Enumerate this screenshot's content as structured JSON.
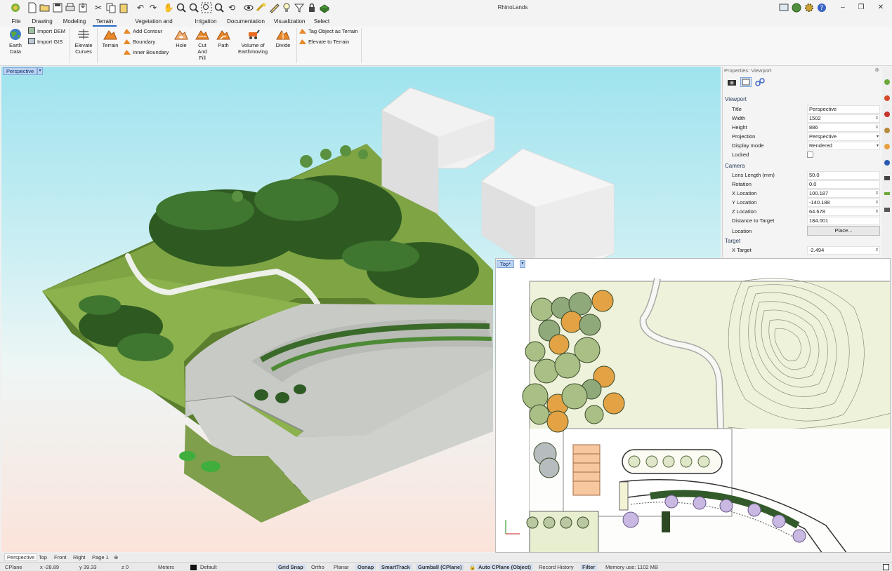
{
  "app": {
    "title": "RhinoLands"
  },
  "quick_access": [
    "rhino-logo-icon",
    "new-icon",
    "open-icon",
    "save-icon",
    "print-icon",
    "import-icon",
    "cut-icon",
    "copy-icon",
    "paste-icon",
    "undo-icon",
    "redo-icon",
    "pan-icon",
    "zoom-icon",
    "zoom-window-icon",
    "zoom-extents-icon",
    "zoom-selected-icon",
    "rotate-view-icon",
    "show-icon",
    "hide-icon",
    "snap-icon",
    "light-icon",
    "filter-icon",
    "lock-icon",
    "render-icon"
  ],
  "menu": {
    "tabs": [
      "File",
      "Drawing",
      "Modeling",
      "Terrain",
      "Vegetation and Hardscape",
      "Irrigation",
      "Documentation",
      "Visualization",
      "Select"
    ],
    "active": "Terrain"
  },
  "ribbon": {
    "earth_data": "Earth\nData",
    "import_dem": "Import DEM",
    "import_gis": "Import GIS",
    "elevate_curves": "Elevate\nCurves",
    "terrain": "Terrain",
    "add_contour": "Add Contour",
    "boundary": "Boundary",
    "inner_boundary": "Inner Boundary",
    "hole": "Hole",
    "cut_and_fill": "Cut\nAnd\nFill",
    "path": "Path",
    "volume_of_earthmoving": "Volume of\nEarthmoving",
    "divide": "Divide",
    "tag_object_as_terrain": "Tag Object as Terrain",
    "elevate_to_terrain": "Elevate to Terrain"
  },
  "viewports": {
    "perspective_label": "Perspective",
    "top_label": "Top*"
  },
  "properties": {
    "panel_title": "Properties: Viewport",
    "viewport_section": "Viewport",
    "camera_section": "Camera",
    "target_section": "Target",
    "viewport_rows": [
      {
        "key": "Title",
        "value": "Perspective"
      },
      {
        "key": "Width",
        "value": "1502"
      },
      {
        "key": "Height",
        "value": "886"
      },
      {
        "key": "Projection",
        "value": "Perspective"
      },
      {
        "key": "Display mode",
        "value": "Rendered"
      },
      {
        "key": "Locked",
        "value": ""
      }
    ],
    "camera_rows": [
      {
        "key": "Lens Length (mm)",
        "value": "50.0"
      },
      {
        "key": "Rotation",
        "value": "0.0"
      },
      {
        "key": "X Location",
        "value": "100.187"
      },
      {
        "key": "Y Location",
        "value": "-140.188"
      },
      {
        "key": "Z Location",
        "value": "64.678"
      },
      {
        "key": "Distance to Target",
        "value": "184.001"
      },
      {
        "key": "Location",
        "value": "Place..."
      }
    ],
    "target_rows": [
      {
        "key": "X Target",
        "value": "-2.494"
      }
    ]
  },
  "viewport_tabs": [
    "Perspective",
    "Top",
    "Front",
    "Right",
    "Page 1"
  ],
  "status_bar": {
    "cplane": "CPlane",
    "x": "x -28.89",
    "y": "y 39.33",
    "z": "z 0",
    "units": "Meters",
    "layer": "Default",
    "grid_snap": "Grid Snap",
    "ortho": "Ortho",
    "planar": "Planar",
    "osnap": "Osnap",
    "smarttrack": "SmartTrack",
    "gumball": "Gumball (CPlane)",
    "auto_cplane": "Auto CPlane (Object)",
    "record_history": "Record History",
    "filter": "Filter",
    "memory": "Memory use: 1102 MB"
  },
  "colors": {
    "accent": "#2b6cc4",
    "viewport_label_bg": "#bcd2ee",
    "grass": "#6f9a3a",
    "plan_green": "#e9efd2"
  }
}
